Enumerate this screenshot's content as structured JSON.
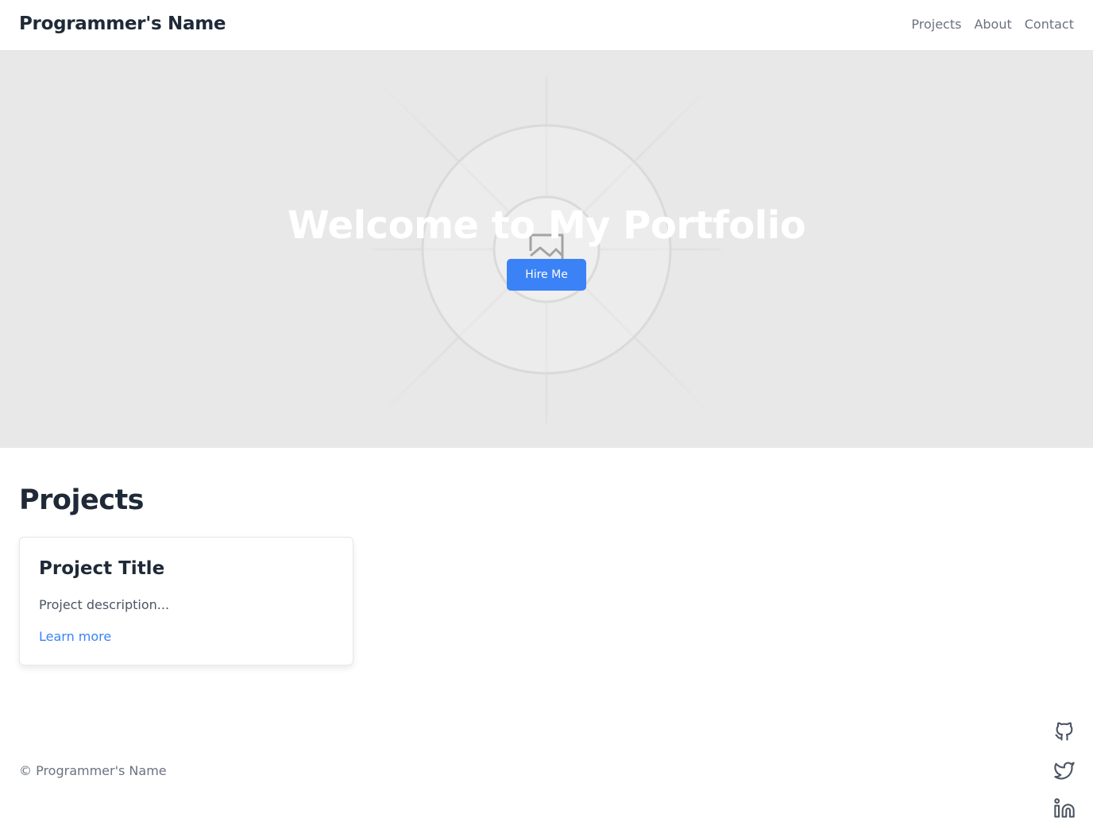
{
  "header": {
    "brand": "Programmer's Name",
    "nav": [
      {
        "label": "Projects"
      },
      {
        "label": "About"
      },
      {
        "label": "Contact"
      }
    ]
  },
  "hero": {
    "title": "Welcome to My Portfolio",
    "cta_label": "Hire Me",
    "image_icon": "image-placeholder-icon"
  },
  "projects": {
    "heading": "Projects",
    "items": [
      {
        "title": "Project Title",
        "description": "Project description...",
        "link_label": "Learn more"
      }
    ]
  },
  "footer": {
    "copyright": "© Programmer's Name",
    "social_icons": [
      "github-icon",
      "twitter-icon",
      "linkedin-icon"
    ]
  },
  "colors": {
    "accent": "#3b82f6",
    "text_dark": "#1f2937",
    "text_muted": "#6b7280",
    "hero_bg": "#e8e8e8"
  }
}
